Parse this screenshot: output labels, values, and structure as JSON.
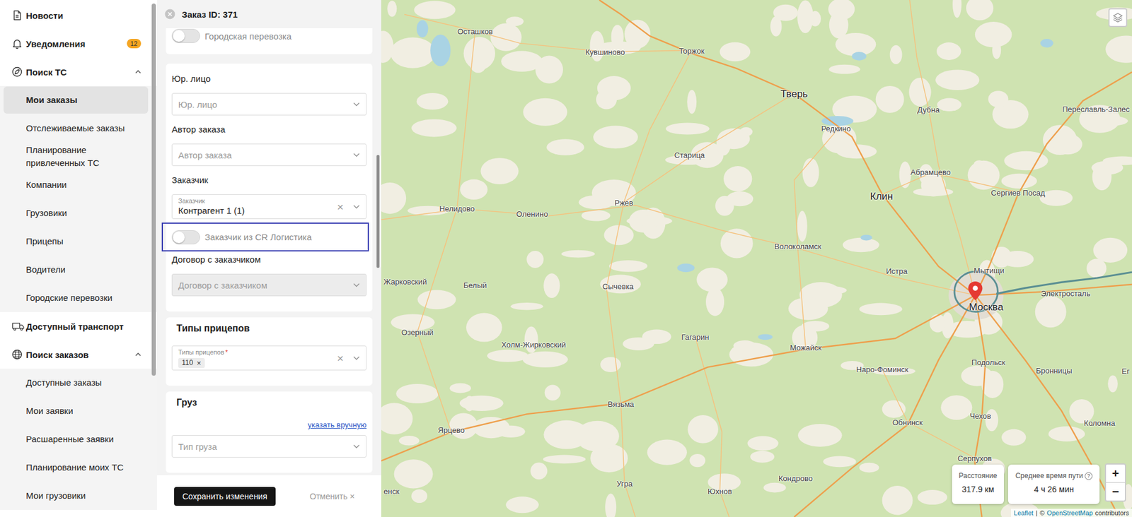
{
  "sidebar": {
    "items": [
      {
        "kind": "link",
        "label": "Новости",
        "selected": false
      },
      {
        "kind": "link",
        "label": "Уведомления",
        "selected": false,
        "badge": "12"
      },
      {
        "kind": "group",
        "label": "Поиск ТС",
        "selected": false,
        "expanded": true
      },
      {
        "kind": "sub",
        "label": "Мои заказы",
        "selected": true
      },
      {
        "kind": "sub",
        "label": "Отслеживаемые заказы",
        "selected": false
      },
      {
        "kind": "sub",
        "label": "Планирование привлеченных ТС",
        "selected": false
      },
      {
        "kind": "sub",
        "label": "Компании",
        "selected": false
      },
      {
        "kind": "sub",
        "label": "Грузовики",
        "selected": false
      },
      {
        "kind": "sub",
        "label": "Прицепы",
        "selected": false
      },
      {
        "kind": "sub",
        "label": "Водители",
        "selected": false
      },
      {
        "kind": "sub",
        "label": "Городские перевозки",
        "selected": false
      },
      {
        "kind": "link",
        "label": "Доступный транспорт",
        "selected": false
      },
      {
        "kind": "group",
        "label": "Поиск заказов",
        "selected": false,
        "expanded": true
      },
      {
        "kind": "sub",
        "label": "Доступные заказы",
        "selected": false
      },
      {
        "kind": "sub",
        "label": "Мои заявки",
        "selected": false
      },
      {
        "kind": "sub",
        "label": "Расшаренные заявки",
        "selected": false
      },
      {
        "kind": "sub",
        "label": "Планирование моих ТС",
        "selected": false
      },
      {
        "kind": "sub",
        "label": "Мои грузовики",
        "selected": false
      }
    ]
  },
  "order": {
    "title": "Заказ ID: 371",
    "sections": [
      {
        "fields": [
          {
            "kind": "toggle",
            "label": "Городская перевозка",
            "on": false,
            "highlighted": false
          }
        ]
      },
      {
        "fields": [
          {
            "kind": "caption",
            "text": "Юр. лицо"
          },
          {
            "kind": "select",
            "placeholder": "Юр. лицо",
            "disabled": false
          },
          {
            "kind": "caption",
            "text": "Автор заказа"
          },
          {
            "kind": "select",
            "placeholder": "Автор заказа",
            "disabled": false
          },
          {
            "kind": "caption",
            "text": "Заказчик"
          },
          {
            "kind": "select",
            "floating_label": "Заказчик",
            "value": "Контрагент 1 (1)",
            "clear": "×",
            "disabled": false
          },
          {
            "kind": "toggle",
            "label": "Заказчик из CR Логистика",
            "on": false,
            "highlighted": true
          },
          {
            "kind": "caption",
            "text": "Договор с заказчиком"
          },
          {
            "kind": "select",
            "placeholder": "Договор с заказчиком",
            "disabled": true
          }
        ]
      },
      {
        "title": "Типы прицепов",
        "fields": [
          {
            "kind": "select",
            "floating_label": "Типы прицепов",
            "required": "*",
            "chips": [
              {
                "label": "110",
                "remove": "×"
              }
            ],
            "clear": "×",
            "disabled": false
          }
        ]
      },
      {
        "title": "Груз",
        "fields": [
          {
            "kind": "link",
            "text": "указать вручную"
          },
          {
            "kind": "select",
            "placeholder": "Тип груза",
            "disabled": false
          }
        ]
      }
    ],
    "footer": {
      "save": "Сохранить изменения",
      "cancel": "Отменить",
      "cancel_icon": "×"
    }
  },
  "map": {
    "cities": [
      {
        "name": "Осташков",
        "major": false
      },
      {
        "name": "Кувшиново",
        "major": false
      },
      {
        "name": "Торжок",
        "major": false
      },
      {
        "name": "Тверь",
        "major": true
      },
      {
        "name": "Дубна",
        "major": false
      },
      {
        "name": "Переславль-Залес",
        "major": false
      },
      {
        "name": "Редкино",
        "major": false
      },
      {
        "name": "Старица",
        "major": false
      },
      {
        "name": "Абрамцево",
        "major": false
      },
      {
        "name": "Сергиев Посад",
        "major": false
      },
      {
        "name": "Клин",
        "major": true
      },
      {
        "name": "Нелидово",
        "major": false
      },
      {
        "name": "Оленино",
        "major": false
      },
      {
        "name": "Ржев",
        "major": false
      },
      {
        "name": "Волоколамск",
        "major": false
      },
      {
        "name": "Истра",
        "major": false
      },
      {
        "name": "Мытищи",
        "major": false
      },
      {
        "name": "Жарковский",
        "major": false
      },
      {
        "name": "Белый",
        "major": false
      },
      {
        "name": "Сычевка",
        "major": false
      },
      {
        "name": "Электросталь",
        "major": false
      },
      {
        "name": "Москва",
        "major": true
      },
      {
        "name": "Озерный",
        "major": false
      },
      {
        "name": "Холм-Жирковский",
        "major": false
      },
      {
        "name": "Гагарин",
        "major": false
      },
      {
        "name": "Можайск",
        "major": false
      },
      {
        "name": "Наро-Фоминск",
        "major": false
      },
      {
        "name": "Подольск",
        "major": false
      },
      {
        "name": "Бронницы",
        "major": false
      },
      {
        "name": "Ег",
        "major": false
      },
      {
        "name": "Вязьма",
        "major": false
      },
      {
        "name": "Ярцево",
        "major": false
      },
      {
        "name": "Обнинск",
        "major": false
      },
      {
        "name": "Чехов",
        "major": false
      },
      {
        "name": "Коломна",
        "major": false
      },
      {
        "name": "Серпухов",
        "major": false
      },
      {
        "name": "Угра",
        "major": false
      },
      {
        "name": "Кондрово",
        "major": false
      },
      {
        "name": "Юхнов",
        "major": false
      },
      {
        "name": "енск",
        "major": false
      }
    ],
    "stats": [
      {
        "label": "Расстояние",
        "value": "317.9 км"
      },
      {
        "label": "Среднее время пути",
        "value": "4 ч 26 мин",
        "info_icon": "?"
      }
    ],
    "zoom": {
      "in": "+",
      "out": "−"
    },
    "attribution": [
      {
        "text": "Leaflet",
        "link": true
      },
      {
        "text": "|",
        "link": false
      },
      {
        "text": "©",
        "link": false
      },
      {
        "text": "OpenStreetMap",
        "link": true
      },
      {
        "text": "contributors",
        "link": false
      }
    ]
  }
}
